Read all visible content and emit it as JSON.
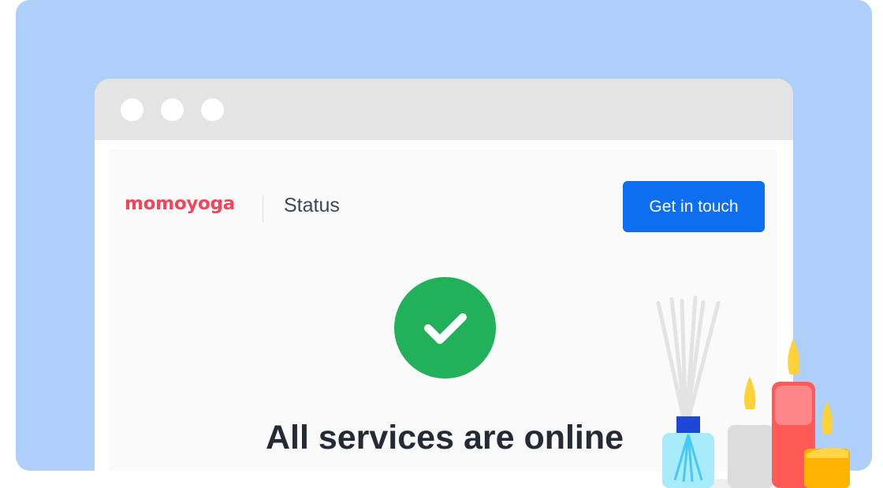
{
  "page": {
    "brand": "momoyoga",
    "section": "Status",
    "cta_label": "Get in touch",
    "status_message": "All services are online"
  },
  "colors": {
    "background_panel": "#aecffa",
    "browser_titlebar": "#e4e4e4",
    "brand": "#f0455a",
    "cta": "#0e6ef0",
    "status_ok": "#22b05b",
    "headline": "#252b36"
  },
  "icons": {
    "status": "checkmark-icon",
    "window_controls": [
      "window-dot-icon",
      "window-dot-icon",
      "window-dot-icon"
    ],
    "decoration": "diffuser-and-candles-illustration"
  }
}
